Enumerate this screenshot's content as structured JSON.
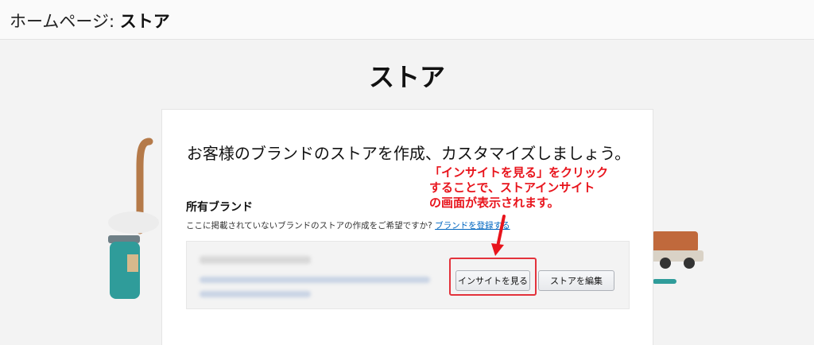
{
  "header": {
    "prefix": "ホームページ: ",
    "title": "ストア"
  },
  "page": {
    "title": "ストア"
  },
  "card": {
    "headline": "お客様のブランドのストアを作成、カスタマイズしましょう。",
    "brands_title": "所有ブランド",
    "hint_text": "ここに掲載されていないブランドのストアの作成をご希望ですか?",
    "hint_link": "ブランドを登録する"
  },
  "brand_row": {
    "view_insights_label": "インサイトを見る",
    "edit_store_label": "ストアを編集"
  },
  "annotation": {
    "lines": [
      "「インサイトを見る」をクリック",
      "することで、ストアインサイト",
      "の画面が表示されます。"
    ]
  },
  "colors": {
    "annotation": "#e8141c",
    "link": "#0066c0"
  }
}
